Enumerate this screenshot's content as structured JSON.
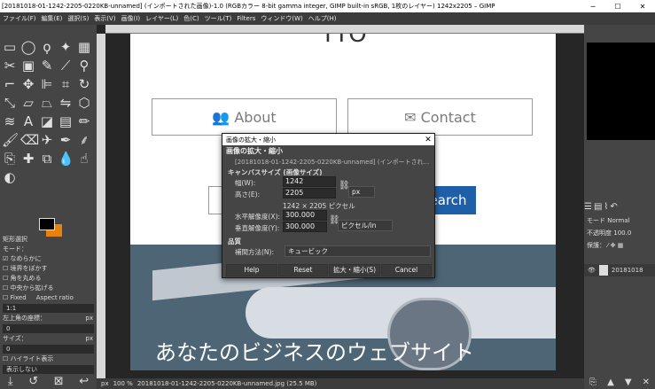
{
  "window_title": "[20181018-01-1242-2205-0220KB-unnamed] (インポートされた画像)-1.0 (RGBカラー 8-bit gamma integer, GIMP built-in sRGB, 1枚のレイヤー) 1242x2205 – GIMP",
  "menu": [
    "ファイル(F)",
    "編集(E)",
    "選択(S)",
    "表示(V)",
    "画像(I)",
    "レイヤー(L)",
    "色(C)",
    "ツール(T)",
    "Filters",
    "ウィンドウ(W)",
    "ヘルプ(H)"
  ],
  "tool_options": {
    "title": "矩形選択",
    "mode_label": "モード：",
    "antialias": "なめらかに",
    "feather": "境界をぼかす",
    "rounded": "角を丸める",
    "expand_center": "中央から拡げる",
    "fixed": "Fixed",
    "aspect": "Aspect ratio",
    "ratio_value": "1:1",
    "position_label": "左上角の座標：",
    "pos_unit": "px",
    "pos_x": "0",
    "pos_y": "0",
    "size_label": "サイズ：",
    "size_unit": "px",
    "size_x": "0",
    "size_y": "0",
    "highlight": "ハイライト表示",
    "guides": "表示しない"
  },
  "canvas": {
    "about": "About",
    "contact": "Contact",
    "search": "Search",
    "headline_fragment": "TTO",
    "banner_text": "あなたのビジネスのウェブサイト"
  },
  "status": {
    "unit": "px",
    "zoom": "100 %",
    "file": "20181018-01-1242-2205-0220KB-unnamed.jpg (25.5 MB)"
  },
  "layers": {
    "mode_label": "モード",
    "mode": "Normal",
    "opacity_label": "不透明度",
    "opacity": "100.0",
    "lock_label": "保護：",
    "layer_name": "20181018"
  },
  "dialog": {
    "title": "画像の拡大・縮小",
    "heading": "画像の拡大・縮小",
    "subtitle": "[20181018-01-1242-2205-0220KB-unnamed] (インポートされ...",
    "canvas_size_label": "キャンバスサイズ (画像サイズ)",
    "width_label": "幅(W):",
    "width": "1242",
    "height_label": "高さ(E):",
    "height": "2205",
    "unit": "px",
    "pixel_info": "1242 × 2205 ピクセル",
    "xres_label": "水平解像度(X):",
    "xres": "300.000",
    "yres_label": "垂直解像度(Y):",
    "yres": "300.000",
    "res_unit": "ピクセル/in",
    "quality_label": "品質",
    "interp_label": "補間方法(N):",
    "interp": "キュービック",
    "btn_help": "Help",
    "btn_reset": "Reset",
    "btn_scale": "拡大・縮小(S)",
    "btn_cancel": "Cancel"
  }
}
